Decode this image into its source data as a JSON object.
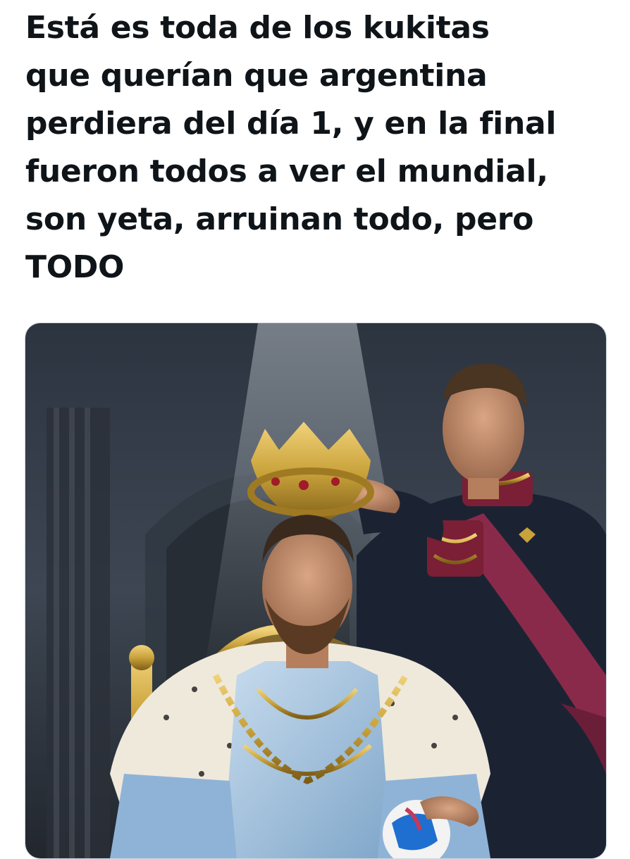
{
  "post": {
    "text": "Está es toda de los kukitas\nque querían que argentina\nperdiera del día 1, y en la final\nfueron todos a ver el mundial,\nson yeta, arruinan todo, pero\nTODO"
  },
  "media": {
    "kind": "photo",
    "colors": {
      "background": "#3a4350",
      "light_beam": "#c9d3dc",
      "crown_gold": "#c9a23a",
      "robe_blue": "#a9c8e6",
      "fur_white": "#efe9dc",
      "uniform_navy": "#1b2333",
      "sash_crimson": "#8a2a4a",
      "skin": "#c58f6e",
      "hair": "#3a2a1e"
    }
  }
}
